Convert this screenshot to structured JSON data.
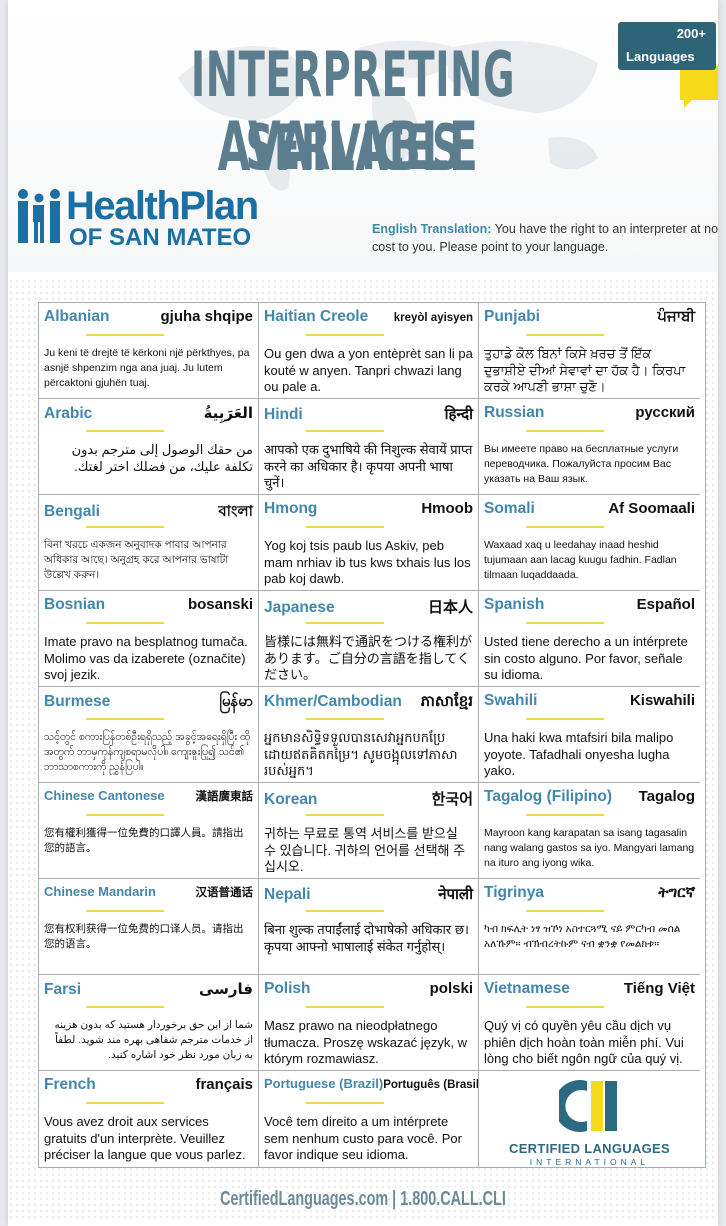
{
  "header": {
    "title_line1": "INTERPRETING SERVICES",
    "title_line2": "AVAILABLE",
    "badge_count": "200+",
    "badge_label": "Languages",
    "logo_line1": "HealthPlan",
    "logo_line2": "OF SAN MATEO",
    "translation_label": "English Translation:",
    "translation_text": "You have the right to an interpreter at no cost to you. Please point to your language."
  },
  "cells": [
    {
      "lang": "Albanian",
      "native": "gjuha shqipe",
      "text": "Ju keni të drejtë të kërkoni një përkthyes, pa asnjë shpenzim nga ana juaj. Ju lutem përcaktoni gjuhën tuaj."
    },
    {
      "lang": "Haitian Creole",
      "native": "kreyòl ayisyen",
      "text": "Ou gen dwa a yon entèprèt san li pa kouté w anyen. Tanpri chwazi lang ou pale a."
    },
    {
      "lang": "Punjabi",
      "native": "ਪੰਜਾਬੀ",
      "text": "ਤੁਹਾਡੇ ਕੋਲ ਬਿਨਾਂ ਕਿਸੇ ਖ਼ਰਚ ਤੋਂ ਇੱਕ ਦੁਭਾਸ਼ੀਏ ਦੀਆਂ ਸੇਵਾਵਾਂ ਦਾ ਹੱਕ ਹੈ। ਕਿਰਪਾ ਕਰਕੇ ਆਪਣੀ ਭਾਸ਼ਾ ਚੁਣੋ।"
    },
    {
      "lang": "Arabic",
      "native": "العَرَبِيةُ",
      "text": "من حقك الوصول إلى مترجم بدون تكلفة عليك، من فضلك اختر لغتك."
    },
    {
      "lang": "Hindi",
      "native": "हिन्दी",
      "text": "आपको एक दुभाषिये की निशुल्क सेवायें प्राप्त करने का अधिकार है। कृपया अपनी भाषा चुनें।"
    },
    {
      "lang": "Russian",
      "native": "русский",
      "text": "Вы имеете право на бесплатные услуги переводчика. Пожалуйста просим Вас указать на Ваш язык."
    },
    {
      "lang": "Bengali",
      "native": "বাংলা",
      "text": "বিনা খরচে একজন অনুবাদক পাবার আপনার অধিকার আছে। অনুগ্রহ করে আপনার ভাষাটা উল্লেখ করুন।"
    },
    {
      "lang": "Hmong",
      "native": "Hmoob",
      "text": "Yog koj tsis paub lus Askiv, peb mam nrhiav ib tus kws txhais lus los pab koj dawb."
    },
    {
      "lang": "Somali",
      "native": "Af Soomaali",
      "text": "Waxaad xaq u leedahay inaad heshid tujumaan aan lacag kuugu fadhin. Fadlan tilmaan luqaddaada."
    },
    {
      "lang": "Bosnian",
      "native": "bosanski",
      "text": "Imate pravo na besplatnog tumača. Molimo vas da izaberete (označite) svoj jezik."
    },
    {
      "lang": "Japanese",
      "native": "日本人",
      "text": "皆様には無料で通訳をつける権利があります。ご自分の言語を指してください。"
    },
    {
      "lang": "Spanish",
      "native": "Español",
      "text": "Usted tiene derecho a un intérprete sin costo alguno. Por favor, señale su idioma."
    },
    {
      "lang": "Burmese",
      "native": "မြန်မာ",
      "text": "သင့်တွင် စကားပြန်တစ်ဦးရရှိသည့် အခွင့်အရေးရှိပြီး ထိုအတွက် ဘာမှကုန်ကျစရာမလိုပါ။ ကျေးဇူးပြု၍ သင်၏ ဘာသာစကားကို ညွှန်ပြပါ။"
    },
    {
      "lang": "Khmer/Cambodian",
      "native": "ភាសាខ្មែរ",
      "text": "អ្នកមានសិទ្ធិទទួលបានសេវាអ្នកបកប្រែ ដោយឥតគិតកម្រៃ។ សូមចង្អុលទៅភាសារបស់អ្នក។"
    },
    {
      "lang": "Swahili",
      "native": "Kiswahili",
      "text": "Una haki kwa mtafsiri bila malipo yoyote. Tafadhali onyesha lugha yako."
    },
    {
      "lang": "Chinese Cantonese",
      "native": "漢語廣東話",
      "text": "您有權利獲得一位免費的口譯人員。請指出您的語言。"
    },
    {
      "lang": "Korean",
      "native": "한국어",
      "text": "귀하는 무료로 통역 서비스를 받으실 수 있습니다. 귀하의 언어를 선택해 주십시오."
    },
    {
      "lang": "Tagalog (Filipino)",
      "native": "Tagalog",
      "text": "Mayroon kang karapatan sa isang tagasalin nang walang gastos sa iyo. Mangyari lamang na ituro ang iyong wika."
    },
    {
      "lang": "Chinese Mandarin",
      "native": "汉语普通话",
      "text": "您有权利获得一位免费的口译人员。请指出您的语言。"
    },
    {
      "lang": "Nepali",
      "native": "नेपाली",
      "text": "बिना शुल्क तपाईंलाई दोभाषेको अधिकार छ। कृपया आफ्नो भाषालाई संकेत गर्नुहोस्।"
    },
    {
      "lang": "Tigrinya",
      "native": "ትግርኛ",
      "text": "ካብ ክፍሊት ነፃ ዝኾነ አስተርጓሚ ናይ ምርካብ መሰል አለኹም። ብኽብረትኩም ናብ ቋንቋ የመልክቱ።"
    },
    {
      "lang": "Farsi",
      "native": "فارسی",
      "text": "شما از این حق برخوردار هستید که بدون هزینه از خدمات مترجم شفاهی بهره مند شوید. لطفاً به زبان مورد نظر خود اشاره کنید."
    },
    {
      "lang": "Polish",
      "native": "polski",
      "text": "Masz prawo na nieodpłatnego tłumacza. Proszę wskazać język, w którym rozmawiasz."
    },
    {
      "lang": "Vietnamese",
      "native": "Tiếng Việt",
      "text": "Quý vị có quyền yêu cầu dịch vụ phiên dịch hoàn toàn miễn phí. Vui lòng cho biết ngôn ngữ của quý vị."
    },
    {
      "lang": "French",
      "native": "français",
      "text": "Vous avez droit aux services gratuits d'un interprète. Veuillez préciser la langue que vous parlez."
    },
    {
      "lang": "Portuguese (Brazil)",
      "native": "Português (Brasil)",
      "text": "Você tem direito a um intérprete sem nenhum custo para você. Por favor indique seu idioma."
    }
  ],
  "cli": {
    "name": "CERTIFIED LANGUAGES",
    "sub": "INTERNATIONAL",
    "tm": "TM"
  },
  "footer": "CertifiedLanguages.com  |  1.800.CALL.CLI",
  "colors": {
    "title": "#5b7d8e",
    "lang_name": "#4287ad",
    "accent_yellow": "#f4da1b",
    "badge": "#2e6477",
    "healthplan_blue": "#1b6fa3"
  }
}
